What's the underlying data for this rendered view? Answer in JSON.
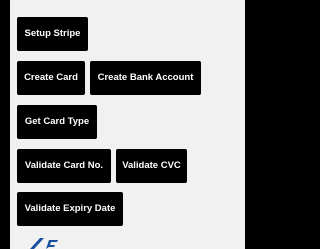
{
  "buttons": {
    "setup_stripe": "Setup Stripe",
    "create_card": "Create Card",
    "create_bank_account": "Create Bank Account",
    "get_card_type": "Get Card Type",
    "validate_card_no": "Validate Card No.",
    "validate_cvc": "Validate CVC",
    "validate_expiry_date": "Validate Expiry Date"
  },
  "colors": {
    "screen_background": "#f1f1f1",
    "button_background": "#000000",
    "button_text": "#ffffff",
    "logo_blue": "#1a4fa0"
  },
  "image": {
    "icon": "card-brand-logo-icon"
  }
}
